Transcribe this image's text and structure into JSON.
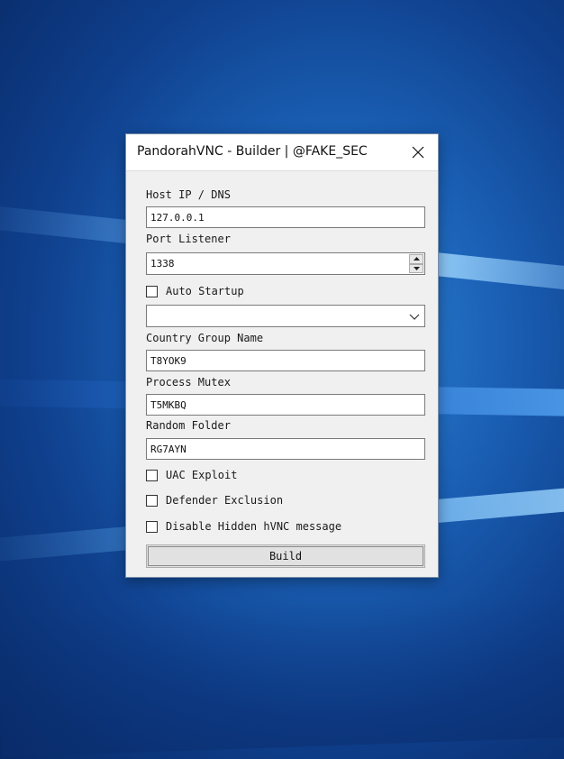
{
  "window": {
    "title": "PandorahVNC - Builder | @FAKE_SEC",
    "close_icon": "close-icon"
  },
  "form": {
    "host_label": "Host IP / DNS",
    "host_value": "127.0.0.1",
    "port_label": "Port Listener",
    "port_value": "1338",
    "auto_startup_label": "Auto Startup",
    "auto_startup_checked": false,
    "startup_dropdown_value": "",
    "country_group_label": "Country Group Name",
    "country_group_value": "T8YOK9",
    "mutex_label": "Process Mutex",
    "mutex_value": "T5MKBQ",
    "random_folder_label": "Random Folder",
    "random_folder_value": "RG7AYN",
    "uac_label": "UAC Exploit",
    "uac_checked": false,
    "defender_label": "Defender Exclusion",
    "defender_checked": false,
    "hvnc_label": "Disable Hidden hVNC message",
    "hvnc_checked": false,
    "build_label": "Build"
  },
  "colors": {
    "desktop_blue": "#1a5fb4",
    "window_bg": "#f0f0f0",
    "titlebar_bg": "#ffffff"
  }
}
